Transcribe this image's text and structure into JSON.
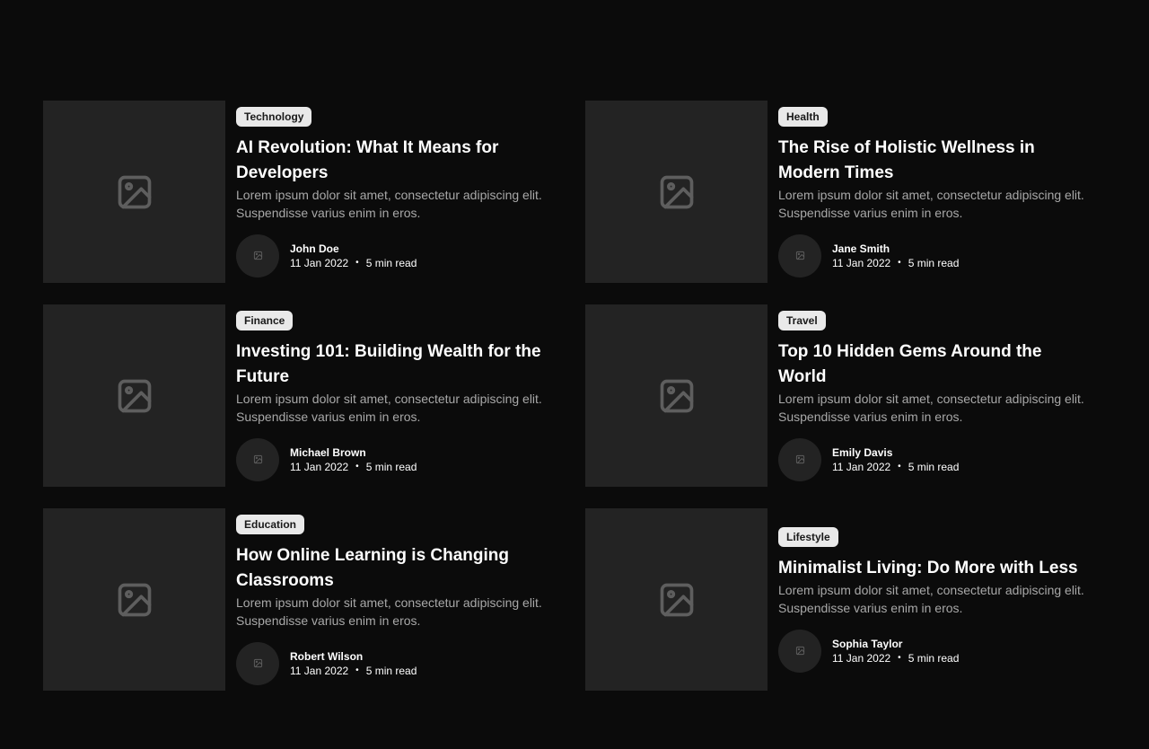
{
  "colors": {
    "background": "#0b0b0b",
    "card_placeholder": "#232323",
    "tag_background": "#e9e9e9",
    "excerpt_text": "#a8a8a8"
  },
  "posts": [
    {
      "category": "Technology",
      "title": "AI Revolution: What It Means for Developers",
      "excerpt": "Lorem ipsum dolor sit amet, consectetur adipiscing elit. Suspendisse varius enim in eros.",
      "author": "John Doe",
      "date": "11 Jan 2022",
      "separator": "•",
      "read_time": "5 min read",
      "image_icon": "image-placeholder-icon"
    },
    {
      "category": "Health",
      "title": "The Rise of Holistic Wellness in Modern Times",
      "excerpt": "Lorem ipsum dolor sit amet, consectetur adipiscing elit. Suspendisse varius enim in eros.",
      "author": "Jane Smith",
      "date": "11 Jan 2022",
      "separator": "•",
      "read_time": "5 min read",
      "image_icon": "image-placeholder-icon"
    },
    {
      "category": "Finance",
      "title": "Investing 101: Building Wealth for the Future",
      "excerpt": "Lorem ipsum dolor sit amet, consectetur adipiscing elit. Suspendisse varius enim in eros.",
      "author": "Michael Brown",
      "date": "11 Jan 2022",
      "separator": "•",
      "read_time": "5 min read",
      "image_icon": "image-placeholder-icon"
    },
    {
      "category": "Travel",
      "title": "Top 10 Hidden Gems Around the World",
      "excerpt": "Lorem ipsum dolor sit amet, consectetur adipiscing elit. Suspendisse varius enim in eros.",
      "author": "Emily Davis",
      "date": "11 Jan 2022",
      "separator": "•",
      "read_time": "5 min read",
      "image_icon": "image-placeholder-icon"
    },
    {
      "category": "Education",
      "title": "How Online Learning is Changing Classrooms",
      "excerpt": "Lorem ipsum dolor sit amet, consectetur adipiscing elit. Suspendisse varius enim in eros.",
      "author": "Robert Wilson",
      "date": "11 Jan 2022",
      "separator": "•",
      "read_time": "5 min read",
      "image_icon": "image-placeholder-icon"
    },
    {
      "category": "Lifestyle",
      "title": "Minimalist Living: Do More with Less",
      "excerpt": "Lorem ipsum dolor sit amet, consectetur adipiscing elit. Suspendisse varius enim in eros.",
      "author": "Sophia Taylor",
      "date": "11 Jan 2022",
      "separator": "•",
      "read_time": "5 min read",
      "image_icon": "image-placeholder-icon"
    }
  ]
}
